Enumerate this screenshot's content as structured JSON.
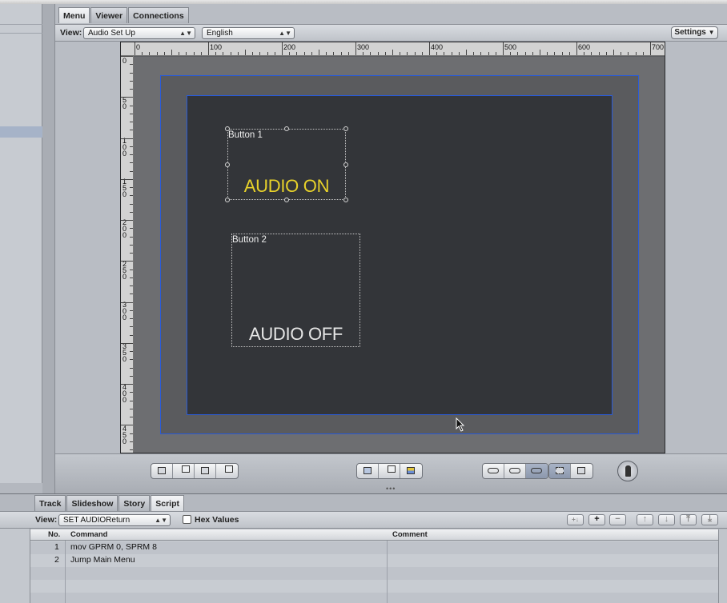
{
  "viewer": {
    "tabs": [
      {
        "label": "Menu",
        "active": true
      },
      {
        "label": "Viewer",
        "active": false
      },
      {
        "label": "Connections",
        "active": false
      }
    ],
    "view_label": "View:",
    "view_value": "Audio Set Up",
    "language_value": "English",
    "settings_label": "Settings"
  },
  "ruler": {
    "h_labels": [
      "0",
      "100",
      "200",
      "300",
      "400",
      "500",
      "600",
      "700"
    ],
    "v_labels": [
      "0",
      "50",
      "100",
      "150",
      "200",
      "250",
      "300",
      "350",
      "400",
      "450"
    ]
  },
  "menu": {
    "buttons": [
      {
        "name": "Button 1",
        "text": "AUDIO ON",
        "color": "#e8d22a",
        "selected": true
      },
      {
        "name": "Button 2",
        "text": "AUDIO OFF",
        "color": "#e6e6e6",
        "selected": false
      }
    ]
  },
  "toolbar": {
    "icons": [
      "bring-forward-icon",
      "send-backward-icon",
      "bring-to-front-icon",
      "send-to-back-icon",
      "add-submenu-icon",
      "add-button-icon",
      "add-text-icon",
      "show-inactive-icon",
      "show-selected-icon",
      "show-activated-icon",
      "title-safe-icon",
      "action-safe-icon",
      "simulator-icon"
    ]
  },
  "inspector": {
    "tabs": [
      {
        "label": "Track",
        "active": false
      },
      {
        "label": "Slideshow",
        "active": false
      },
      {
        "label": "Story",
        "active": false
      },
      {
        "label": "Script",
        "active": true
      }
    ],
    "view_label": "View:",
    "view_value": "SET AUDIOReturn",
    "hex_label": "Hex Values",
    "hex_checked": false,
    "columns": {
      "no": "No.",
      "command": "Command",
      "comment": "Comment"
    },
    "rows": [
      {
        "no": "1",
        "command": "mov GPRM 0, SPRM 8",
        "comment": ""
      },
      {
        "no": "2",
        "command": "Jump Main Menu",
        "comment": ""
      }
    ],
    "buttons": [
      "+",
      "−"
    ]
  }
}
